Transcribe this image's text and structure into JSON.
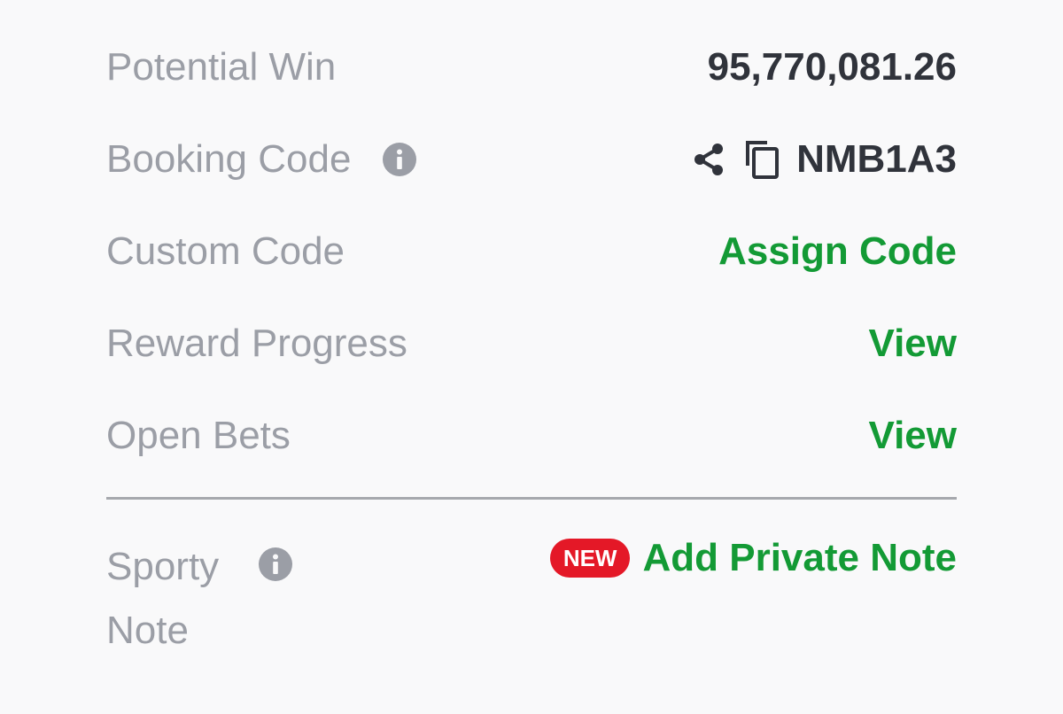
{
  "rows": {
    "potential_win": {
      "label": "Potential Win",
      "value": "95,770,081.26"
    },
    "booking_code": {
      "label": "Booking Code",
      "value": "NMB1A3",
      "info_icon": "info-icon",
      "share_icon": "share-icon",
      "copy_icon": "copy-icon"
    },
    "custom_code": {
      "label": "Custom Code",
      "action": "Assign Code"
    },
    "reward_progress": {
      "label": "Reward Progress",
      "action": "View"
    },
    "open_bets": {
      "label": "Open Bets",
      "action": "View"
    },
    "sporty_note": {
      "label_line1": "Sporty",
      "label_line2": "Note",
      "info_icon": "info-icon",
      "badge": "NEW",
      "action": "Add Private Note"
    }
  },
  "colors": {
    "background": "#f9f9fa",
    "label": "#9b9ea6",
    "value": "#30333b",
    "accent_green": "#139a35",
    "badge_red": "#e41827",
    "divider": "#a6a8ad"
  }
}
